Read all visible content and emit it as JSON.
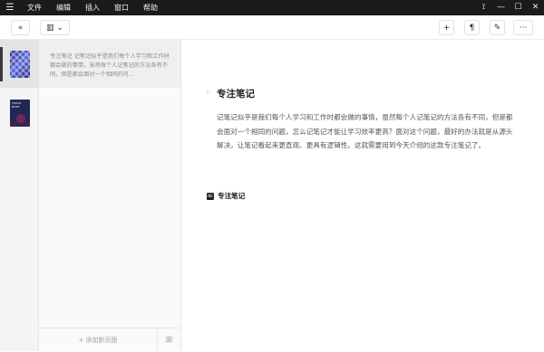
{
  "menubar": {
    "hamburger_icon": "hamburger-menu-icon",
    "items": [
      "文件",
      "编辑",
      "插入",
      "窗口",
      "帮助"
    ],
    "controls": [
      "pin-icon",
      "minimize-icon",
      "maximize-icon",
      "close-icon"
    ]
  },
  "toolbar": {
    "back_label": "«",
    "layout_label": "▥ ⌄",
    "add_label": "+",
    "font_label": "¶",
    "magic_label": "✎",
    "more_label": "···"
  },
  "thumbnails": [
    {
      "name": "notebook-cover-1"
    },
    {
      "name": "notebook-cover-2",
      "text": "FOCUS NOTE"
    }
  ],
  "pagelist": {
    "entry_preview": "专注笔记 记笔记似乎是我们每个人学习和工作时都会做的事情，虽然每个人记笔记的方法各有不同，但是都会面对一个相同的问…",
    "add_page_label": "+ 添加新页面",
    "layout_icon_label": "⊞"
  },
  "editor": {
    "drag_handle": "⠿",
    "title": "专注笔记",
    "body": "记笔记似乎是我们每个人学习和工作时都会做的事情，虽然每个人记笔记的方法各有不同，但是都会面对一个相同的问题，怎么记笔记才能让学习效率更高？面对这个问题，最好的办法就是从源头解决，让笔记看起来更直观、更具有逻辑性。这就需要用到今天介绍的这款专注笔记了。",
    "embed_icon_label": "NE",
    "embed_label": "专注笔记"
  }
}
